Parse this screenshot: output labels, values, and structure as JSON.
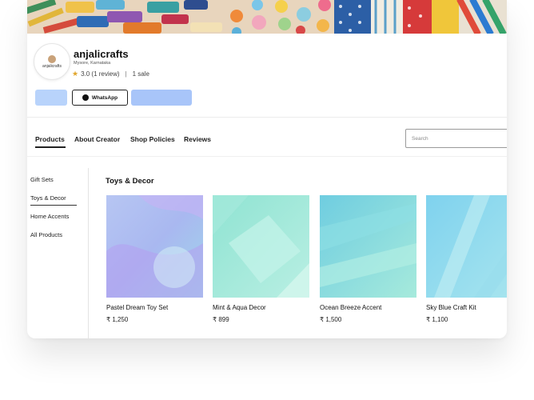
{
  "shop": {
    "logo_text": "anjalicrafts",
    "name": "anjalicrafts",
    "location": "Mysore, Karnataka",
    "rating": "3.0 (1 review)",
    "separator": "|",
    "sales": "1 sale"
  },
  "actions": {
    "whatsapp_label": "WhatsApp"
  },
  "tabs": [
    {
      "label": "Products",
      "active": true
    },
    {
      "label": "About Creator",
      "active": false
    },
    {
      "label": "Shop Policies",
      "active": false
    },
    {
      "label": "Reviews",
      "active": false
    }
  ],
  "search": {
    "placeholder": "Search",
    "value": ""
  },
  "sidebar": {
    "items": [
      {
        "label": "Gift Sets",
        "active": false
      },
      {
        "label": "Toys & Decor",
        "active": true
      },
      {
        "label": "Home Accents",
        "active": false
      },
      {
        "label": "All Products",
        "active": false
      }
    ]
  },
  "section": {
    "title": "Toys & Decor"
  },
  "products": [
    {
      "name": "Pastel Dream Toy Set",
      "price": "₹ 1,250"
    },
    {
      "name": "Mint & Aqua Decor",
      "price": "₹ 899"
    },
    {
      "name": "Ocean Breeze Accent",
      "price": "₹ 1,500"
    },
    {
      "name": "Sky Blue Craft Kit",
      "price": "₹ 1,100"
    }
  ],
  "colors": {
    "accent_button_1": "#b8d3fb",
    "accent_button_2": "#a8c5f9",
    "star": "#e0a52b"
  },
  "icons": {
    "rating": "star-icon",
    "whatsapp": "whatsapp-icon"
  }
}
